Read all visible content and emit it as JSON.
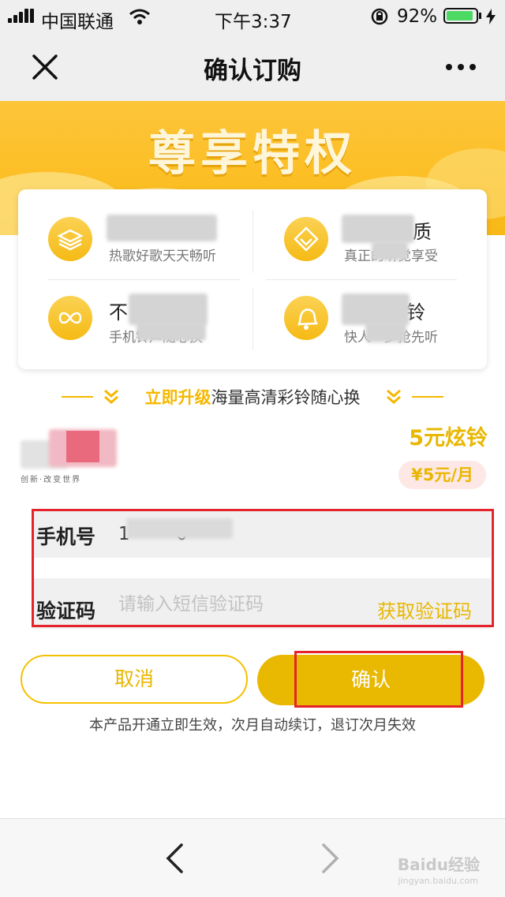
{
  "status_bar": {
    "carrier": "中国联通",
    "time": "下午3:37",
    "battery": "92%",
    "battery_level": 0.92
  },
  "nav": {
    "title": "确认订购"
  },
  "banner": {
    "title": "尊享特权"
  },
  "features": [
    {
      "title": "",
      "subtitle": "热歌好歌天天畅听",
      "icon": "layers-icon"
    },
    {
      "title": "质",
      "subtitle": "真正的听觉享受",
      "icon": "diamond-icon"
    },
    {
      "title": "不",
      "subtitle": "手机铃声随心换",
      "icon": "infinity-icon"
    },
    {
      "title": "铃",
      "subtitle": "快人一步抢先听",
      "icon": "bell-icon"
    }
  ],
  "promo": {
    "highlight": "立即升级",
    "rest": "海量高清彩铃随心换"
  },
  "product": {
    "name": "5元炫铃",
    "price": "¥5元/月",
    "logo_slogan": "创新·改变世界"
  },
  "form": {
    "phone_label": "手机号",
    "phone_value": "1        0",
    "code_label": "验证码",
    "code_placeholder": "请输入短信验证码",
    "get_code_label": "获取验证码"
  },
  "buttons": {
    "cancel": "取消",
    "confirm": "确认"
  },
  "notice": "本产品开通立即生效，次月自动续订，退订次月失效",
  "watermark": {
    "brand": "Baidu经验",
    "url": "jingyan.baidu.com"
  },
  "colors": {
    "accent": "#e9b700",
    "highlight_red": "#e5232b"
  }
}
